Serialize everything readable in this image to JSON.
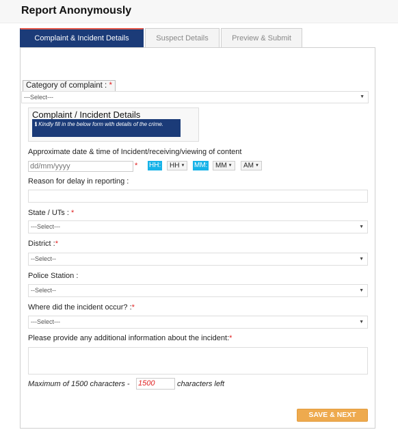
{
  "page": {
    "title": "Report Anonymously"
  },
  "tabs": [
    {
      "label": "Complaint & Incident Details",
      "active": true
    },
    {
      "label": "Suspect Details",
      "active": false
    },
    {
      "label": "Preview & Submit",
      "active": false
    }
  ],
  "category": {
    "label": "Category of complaint :",
    "required_mark": "*",
    "value": "---Select---"
  },
  "info_box": {
    "title": "Complaint / Incident Details",
    "icon": "info-icon",
    "note": "Kindly fill in the below form with details of the crime."
  },
  "date_time": {
    "label": "Approximate date & time of Incident/receiving/viewing of content",
    "date_placeholder": "dd/mm/yyyy",
    "required_mark": "*",
    "hour_tag": "HH:",
    "hour_value": "HH",
    "minute_tag": "MM:",
    "minute_value": "MM",
    "ampm_value": "AM",
    "caret": "▼"
  },
  "delay_reason": {
    "label": "Reason for delay in reporting :",
    "value": ""
  },
  "state": {
    "label": "State / UTs :",
    "required_mark": "*",
    "value": "---Select---"
  },
  "district": {
    "label": "District :",
    "required_mark": "*",
    "value": "--Select--"
  },
  "police_station": {
    "label": "Police Station :",
    "value": "--Select--"
  },
  "incident_place": {
    "label": "Where did the incident occur? :",
    "required_mark": "*",
    "value": "---Select---"
  },
  "additional_info": {
    "label": "Please provide any additional information about the incident:",
    "required_mark": "*",
    "value": ""
  },
  "char_counter": {
    "prefix": "Maximum of 1500 characters -",
    "remaining": "1500",
    "suffix": "characters left"
  },
  "actions": {
    "save_next": "SAVE & NEXT"
  },
  "colors": {
    "primary": "#1b3b78",
    "accent": "#eeaa4e",
    "time_tag": "#17b3e8",
    "required": "#e02020"
  }
}
